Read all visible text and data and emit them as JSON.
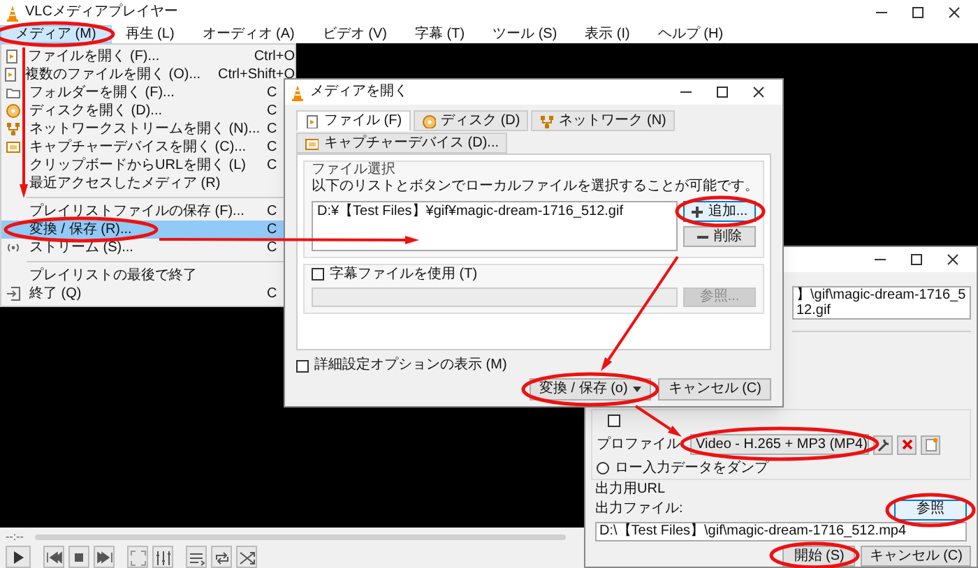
{
  "window": {
    "title": "VLCメディアプレイヤー"
  },
  "menubar": [
    {
      "label": "メディア (M)",
      "selected": true
    },
    {
      "label": "再生 (L)",
      "selected": false
    },
    {
      "label": "オーディオ (A)",
      "selected": false
    },
    {
      "label": "ビデオ (V)",
      "selected": false
    },
    {
      "label": "字幕 (T)",
      "selected": false
    },
    {
      "label": "ツール (S)",
      "selected": false
    },
    {
      "label": "表示 (I)",
      "selected": false
    },
    {
      "label": "ヘルプ (H)",
      "selected": false
    }
  ],
  "media_menu": [
    {
      "kind": "item",
      "label": "ファイルを開く (F)...",
      "shortcut": "Ctrl+O",
      "selected": false
    },
    {
      "kind": "item",
      "label": "複数のファイルを開く (O)...",
      "shortcut": "Ctrl+Shift+O",
      "selected": false
    },
    {
      "kind": "item",
      "label": "フォルダーを開く (F)...",
      "shortcut": "C",
      "selected": false
    },
    {
      "kind": "item",
      "label": "ディスクを開く (D)...",
      "shortcut": "C",
      "selected": false
    },
    {
      "kind": "item",
      "label": "ネットワークストリームを開く (N)...",
      "shortcut": "C",
      "selected": false
    },
    {
      "kind": "item",
      "label": "キャプチャーデバイスを開く (C)...",
      "shortcut": "C",
      "selected": false
    },
    {
      "kind": "item",
      "label": "クリップボードからURLを開く (L)",
      "shortcut": "C",
      "selected": false
    },
    {
      "kind": "item",
      "label": "最近アクセスしたメディア (R)",
      "selected": false
    },
    {
      "kind": "separator"
    },
    {
      "kind": "item",
      "label": "プレイリストファイルの保存 (F)...",
      "shortcut": "C",
      "selected": false
    },
    {
      "kind": "item",
      "label": "変換 / 保存 (R)...",
      "shortcut": "C",
      "selected": true
    },
    {
      "kind": "item",
      "label": "ストリーム (S)...",
      "shortcut": "C",
      "selected": false
    },
    {
      "kind": "separator"
    },
    {
      "kind": "item",
      "label": "プレイリストの最後で終了",
      "selected": false
    },
    {
      "kind": "item",
      "label": "終了 (Q)",
      "shortcut": "C",
      "selected": false
    }
  ],
  "controls": {
    "time": "--:--"
  },
  "open_dialog": {
    "title": "メディアを開く",
    "tabs": [
      {
        "label": "ファイル (F)",
        "selected": true
      },
      {
        "label": "ディスク (D)",
        "selected": false
      },
      {
        "label": "ネットワーク (N)",
        "selected": false
      },
      {
        "label": "キャプチャーデバイス (D)...",
        "selected": false
      }
    ],
    "file_group": {
      "title": "ファイル選択",
      "hint": "以下のリストとボタンでローカルファイルを選択することが可能です。",
      "files": [
        "D:¥【Test Files】¥gif¥magic-dream-1716_512.gif"
      ],
      "add_button": "追加...",
      "remove_button": "削除"
    },
    "subtitle": {
      "label": "字幕ファイルを使用 (T)",
      "checked": false,
      "browse_button": "参照...",
      "browse_disabled": true
    },
    "advanced": {
      "label": "詳細設定オプションの表示 (M)",
      "checked": false
    },
    "convert_button": "変換 / 保存 (o)",
    "cancel_button": "キャンセル (C)"
  },
  "convert_dialog": {
    "source_file": "】\\gif\\magic-dream-1716_512.gif",
    "display_checkbox": {
      "checked": false
    },
    "profile": {
      "label": "プロファイル",
      "value": "Video - H.265 + MP3 (MP4)"
    },
    "raw_dump": {
      "label": "ロー入力データをダンプ",
      "selected": false
    },
    "output": {
      "title": "出力用URL",
      "label": "出力ファイル:",
      "value": "D:\\【Test Files】\\gif\\magic-dream-1716_512.mp4",
      "browse_button": "参照"
    },
    "start_button": "開始 (S)",
    "cancel_button": "キャンセル (C)"
  }
}
